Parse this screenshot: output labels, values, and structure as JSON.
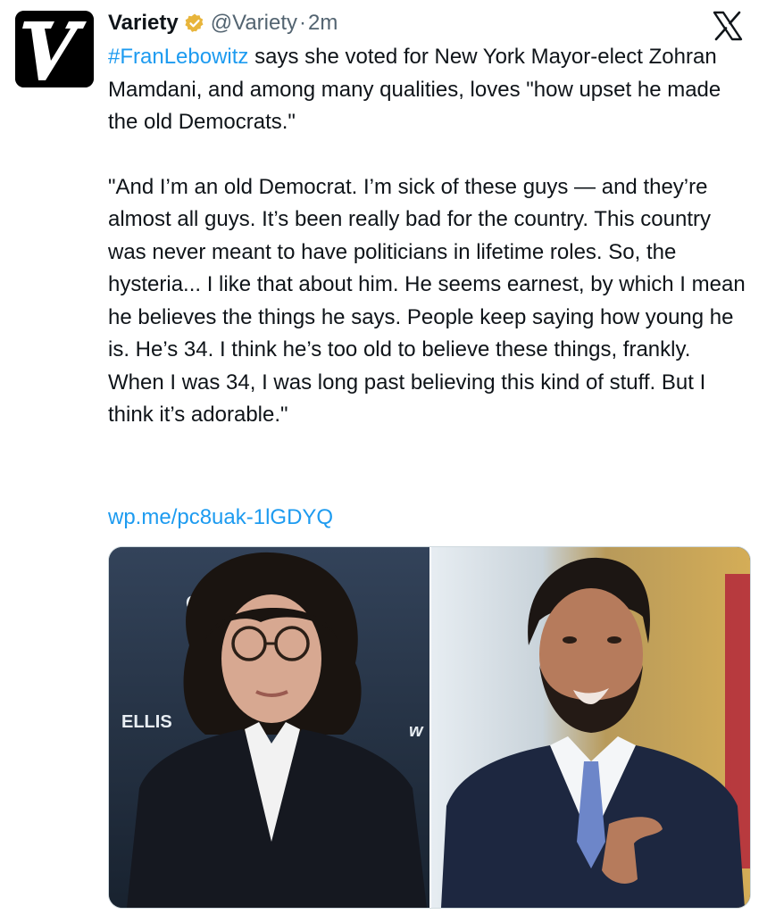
{
  "account": {
    "name": "Variety",
    "handle": "@Variety",
    "separator": "·",
    "time": "2m",
    "avatar_letter": "V",
    "verified": true,
    "verified_color": "#e8b53b"
  },
  "tweet": {
    "hashtag": "#FranLebowitz",
    "lead": " says she voted for New York Mayor-elect Zohran Mamdani, and among many qualities, loves \"how upset he made the old Democrats.\"",
    "quote": "\"And I’m an old Democrat. I’m sick of these guys — and they’re almost all guys. It’s been really bad for the country. This country was never meant to have politicians in lifetime roles. So, the hysteria... I like that about him. He seems earnest, by which I mean he believes the things he says. People keep saying how young he is. He’s 34. I think he’s too old to believe these things, frankly. When I was 34, I was long past believing this kind of stuff. But I think it’s adorable.\"",
    "link": "wp.me/pc8uak-1lGDYQ"
  },
  "media": {
    "backdrop_text_1": "CA",
    "backdrop_text_2": "ELLIS",
    "backdrop_text_3": "w"
  },
  "icons": {
    "platform_logo": "x-logo-icon",
    "verified": "verified-badge-icon"
  },
  "colors": {
    "link": "#1d9bf0",
    "muted": "#536471",
    "text": "#0f1419"
  }
}
